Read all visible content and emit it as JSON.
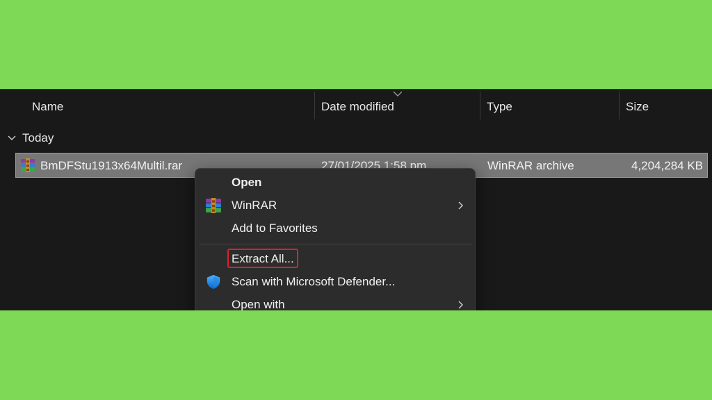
{
  "columns": {
    "name": "Name",
    "date_modified": "Date modified",
    "type": "Type",
    "size": "Size"
  },
  "group": {
    "label": "Today",
    "expanded": true
  },
  "file": {
    "name": "BmDFStu1913x64Multil.rar",
    "date_modified": "27/01/2025 1:58 pm",
    "type": "WinRAR archive",
    "size": "4,204,284 KB",
    "icon": "winrar-icon"
  },
  "context_menu": {
    "items": [
      {
        "label": "Open",
        "bold": true,
        "icon": null,
        "submenu": false
      },
      {
        "label": "WinRAR",
        "bold": false,
        "icon": "winrar-icon",
        "submenu": true
      },
      {
        "label": "Add to Favorites",
        "bold": false,
        "icon": null,
        "submenu": false
      },
      {
        "label": "Extract All...",
        "bold": false,
        "icon": null,
        "submenu": false,
        "highlighted": true
      },
      {
        "label": "Scan with Microsoft Defender...",
        "bold": false,
        "icon": "defender-shield-icon",
        "submenu": false
      },
      {
        "label": "Open with",
        "bold": false,
        "icon": null,
        "submenu": true
      }
    ]
  },
  "colors": {
    "background": "#7ed957",
    "explorer_bg": "#191919",
    "selected_row": "#777777",
    "menu_bg": "#2c2c2c",
    "highlight_outline": "#e0202a"
  }
}
